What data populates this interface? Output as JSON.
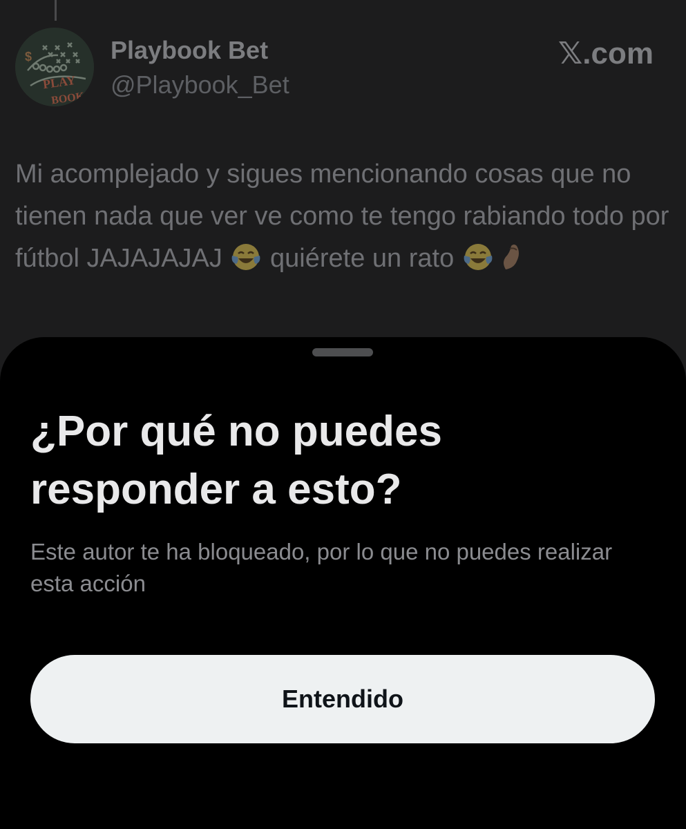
{
  "tweet": {
    "author_name": "Playbook Bet",
    "author_handle": "@Playbook_Bet",
    "source_label": "𝕏.com",
    "avatar_text_top": "PLAY",
    "avatar_text_bottom": "BOOK",
    "avatar_symbol": "$",
    "text_part1": "Mi acomplejado y sigues mencionando cosas que no tienen nada que ver ve como te tengo rabiando todo por fútbol JAJAJAJAJ ",
    "text_part2": " quiérete un rato ",
    "emoji_1": "face-with-tears-of-joy-icon",
    "emoji_2": "face-with-tears-of-joy-icon",
    "emoji_3": "pinched-fingers-icon"
  },
  "sheet": {
    "title": "¿Por qué no puedes responder a esto?",
    "body": "Este autor te ha bloqueado, por lo que no puedes realizar esta acción",
    "button_label": "Entendido"
  },
  "colors": {
    "sheet_background": "#000000",
    "button_background": "#eef1f2",
    "overlay_dim": "#1c1c1d"
  }
}
